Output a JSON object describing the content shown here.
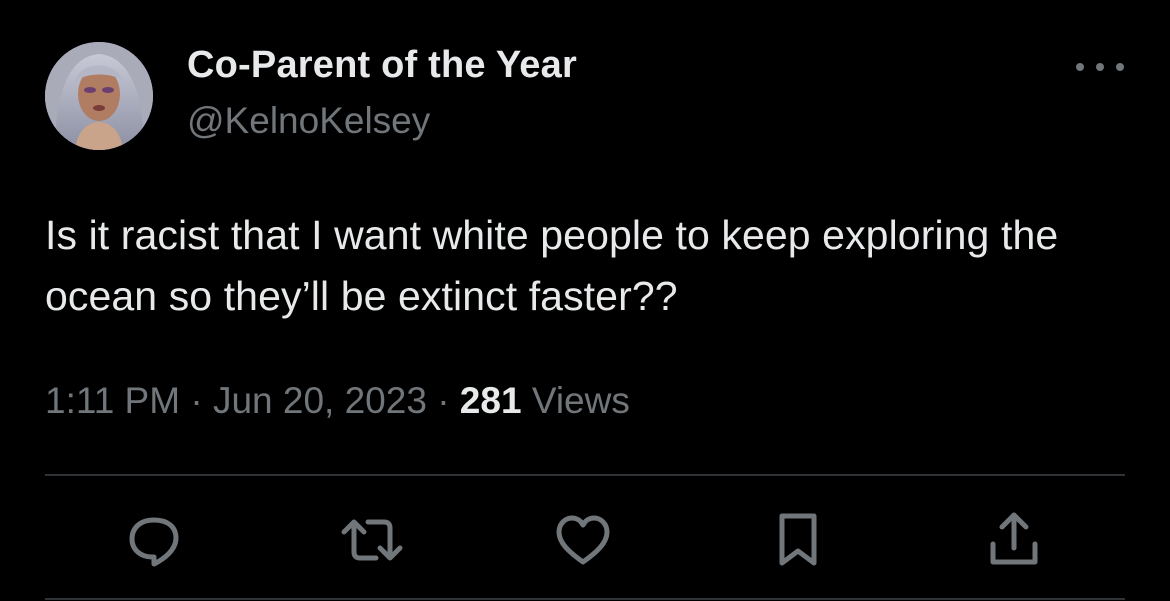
{
  "tweet": {
    "author": {
      "display_name": "Co-Parent of the Year",
      "handle": "@KelnoKelsey",
      "avatar": "profile-photo"
    },
    "text": "Is it racist that I want white people to keep exploring the ocean so they’ll be extinct faster??",
    "time": "1:11 PM",
    "date": "Jun 20, 2023",
    "separator": "·",
    "views_count": "281",
    "views_label": "Views"
  },
  "icons": {
    "more": "more-horizontal-icon",
    "reply": "reply-icon",
    "retweet": "retweet-icon",
    "like": "heart-icon",
    "bookmark": "bookmark-icon",
    "share": "share-icon"
  },
  "colors": {
    "background": "#000000",
    "primary_text": "#e7e9ea",
    "secondary_text": "#71767b",
    "divider": "#2f3336"
  }
}
